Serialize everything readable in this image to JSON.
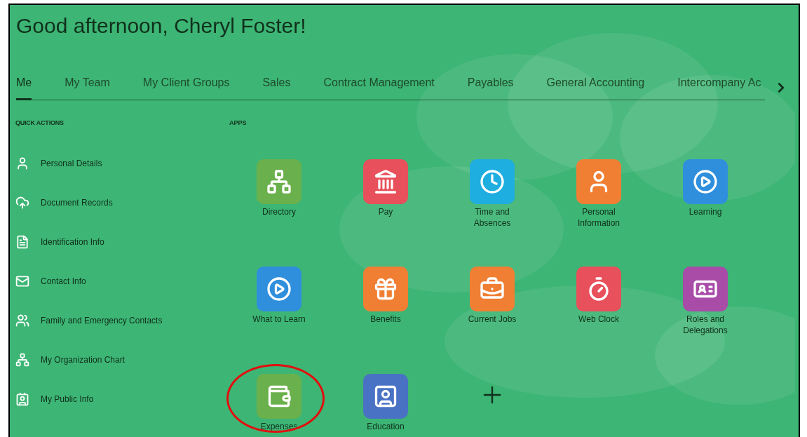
{
  "greeting": "Good afternoon, Cheryl Foster!",
  "tabs": [
    {
      "label": "Me",
      "selected": true
    },
    {
      "label": "My Team",
      "selected": false
    },
    {
      "label": "My Client Groups",
      "selected": false
    },
    {
      "label": "Sales",
      "selected": false
    },
    {
      "label": "Contract Management",
      "selected": false
    },
    {
      "label": "Payables",
      "selected": false
    },
    {
      "label": "General Accounting",
      "selected": false
    },
    {
      "label": "Intercompany Ac",
      "selected": false
    }
  ],
  "quick_actions": {
    "heading": "QUICK ACTIONS",
    "items": [
      "Personal Details",
      "Document Records",
      "Identification Info",
      "Contact Info",
      "Family and Emergency Contacts",
      "My Organization Chart",
      "My Public Info"
    ]
  },
  "apps": {
    "heading": "APPS",
    "items": [
      {
        "label": "Directory",
        "color": "#6ab04c"
      },
      {
        "label": "Pay",
        "color": "#e8505b"
      },
      {
        "label": "Time and Absences",
        "color": "#1eaee0"
      },
      {
        "label": "Personal Information",
        "color": "#f07f34"
      },
      {
        "label": "Learning",
        "color": "#2f8fdc"
      },
      {
        "label": "What to Learn",
        "color": "#2f8fdc"
      },
      {
        "label": "Benefits",
        "color": "#f07f34"
      },
      {
        "label": "Current Jobs",
        "color": "#f07f34"
      },
      {
        "label": "Web Clock",
        "color": "#e8505b"
      },
      {
        "label": "Roles and Delegations",
        "color": "#a84ca8"
      },
      {
        "label": "Expenses",
        "color": "#6ab04c",
        "circled": true
      },
      {
        "label": "Education",
        "color": "#4a72c4"
      }
    ]
  }
}
